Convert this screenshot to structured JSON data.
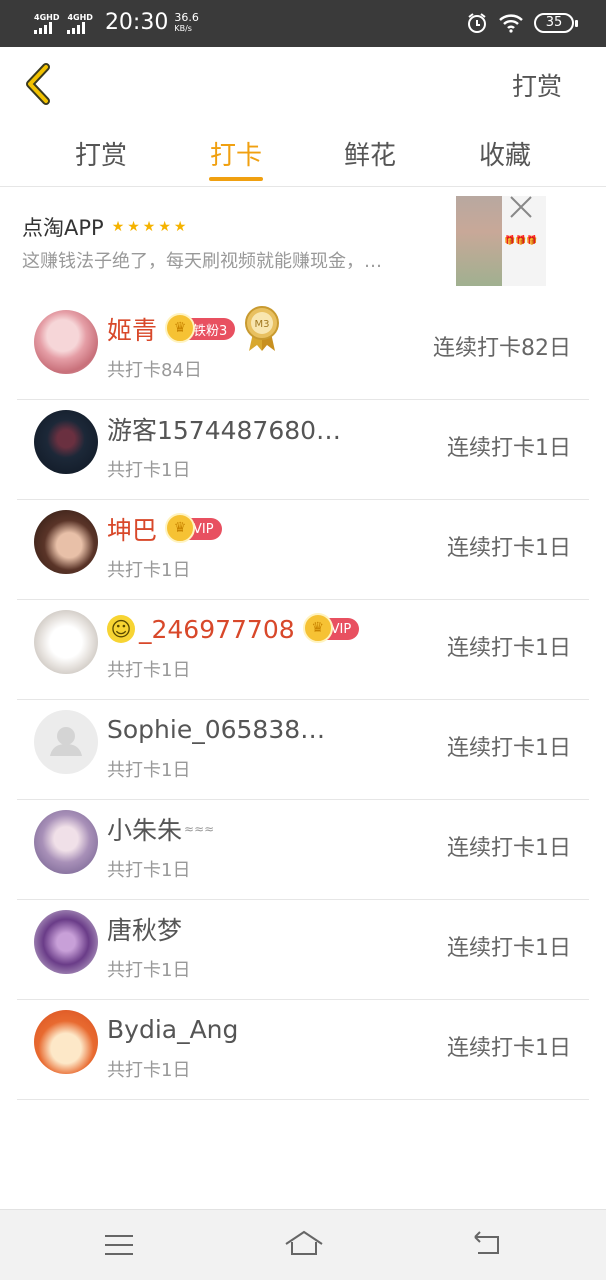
{
  "status_bar": {
    "network_1": "4GHD",
    "network_2": "4GHD",
    "time": "20:30",
    "speed_value": "36.6",
    "speed_unit": "KB/s",
    "battery": "35"
  },
  "header": {
    "right_action": "打赏"
  },
  "tabs": [
    {
      "label": "打赏",
      "active": false
    },
    {
      "label": "打卡",
      "active": true
    },
    {
      "label": "鲜花",
      "active": false
    },
    {
      "label": "收藏",
      "active": false
    }
  ],
  "ad": {
    "title": "点淘APP",
    "stars": "★★★★★",
    "description": "这赚钱法子绝了，每天刷视频就能赚现金，…"
  },
  "list": [
    {
      "name": "姬青",
      "badge": "铁粉3",
      "medal": "M3",
      "total": "共打卡84日",
      "streak": "连续打卡82日"
    },
    {
      "name": "游客1574487680…",
      "total": "共打卡1日",
      "streak": "连续打卡1日"
    },
    {
      "name": "坤巴",
      "badge": "VIP",
      "total": "共打卡1日",
      "streak": "连续打卡1日"
    },
    {
      "name": "_246977708",
      "badge": "VIP",
      "total": "共打卡1日",
      "streak": "连续打卡1日"
    },
    {
      "name": "Sophie_065838…",
      "total": "共打卡1日",
      "streak": "连续打卡1日"
    },
    {
      "name": "小朱朱",
      "total": "共打卡1日",
      "streak": "连续打卡1日"
    },
    {
      "name": "唐秋梦",
      "total": "共打卡1日",
      "streak": "连续打卡1日"
    },
    {
      "name": "Bydia_Ang",
      "total": "共打卡1日",
      "streak": "连续打卡1日"
    }
  ],
  "colors": {
    "accent": "#f0a010",
    "vip_red": "#d8482a",
    "badge_red": "#e85060"
  }
}
